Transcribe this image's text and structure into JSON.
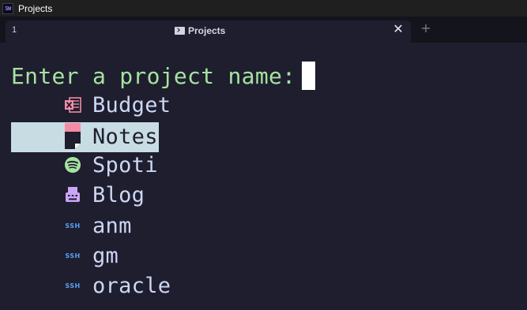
{
  "window": {
    "title": "Projects",
    "app_icon_text": "SW"
  },
  "tabbar": {
    "tab_index": "1",
    "tab_title": "Projects",
    "close_glyph": "✕",
    "new_tab_glyph": "+"
  },
  "terminal": {
    "prompt": "Enter a project name:",
    "input_value": "",
    "items": [
      {
        "label": "Budget",
        "icon": "excel-icon",
        "color": "#f38ba8"
      },
      {
        "label": "Notes",
        "icon": "note-icon",
        "color": "#f38ba8",
        "selected": true
      },
      {
        "label": "Spoti",
        "icon": "spotify-icon",
        "color": "#a6e3a1"
      },
      {
        "label": "Blog",
        "icon": "typewriter-icon",
        "color": "#cba6f7"
      },
      {
        "label": "anm",
        "icon": "ssh-icon",
        "icon_text": "SSH",
        "color": "#5aa0f0"
      },
      {
        "label": "gm",
        "icon": "ssh-icon",
        "icon_text": "SSH",
        "color": "#5aa0f0"
      },
      {
        "label": "oracle",
        "icon": "ssh-icon",
        "icon_text": "SSH",
        "color": "#5aa0f0"
      }
    ]
  },
  "colors": {
    "background": "#1e1e2e",
    "prompt": "#a6e3a1",
    "text": "#cdd6f4",
    "selection": "#c8dce4",
    "titlebar": "#1f1f1f"
  }
}
